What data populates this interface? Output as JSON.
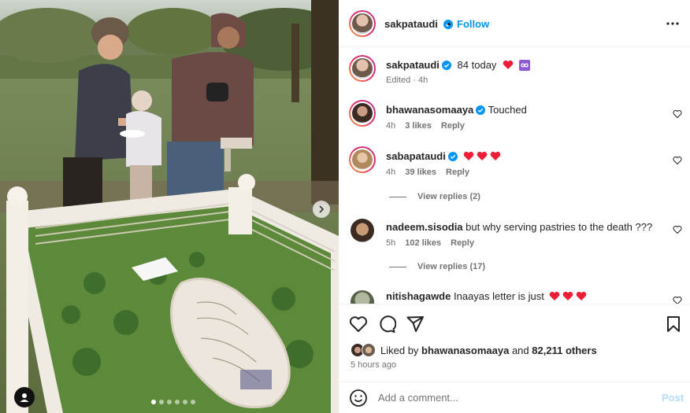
{
  "colors": {
    "accent": "#0095f6",
    "heart_red": "#ed1f36",
    "muted": "#737373",
    "text": "#262626"
  },
  "photo": {
    "slide_count": 6,
    "active_slide": 1,
    "next_icon": "chevron-right-icon",
    "tag_icon": "user-tag-icon"
  },
  "header": {
    "username": "sakpataudi",
    "separator": "•",
    "follow_label": "Follow",
    "more_icon": "more-horizontal-icon"
  },
  "caption": {
    "username": "sakpataudi",
    "text": "84 today",
    "emojis": [
      "red-heart",
      "infinity"
    ],
    "edited": "Edited · 4h"
  },
  "comments": [
    {
      "username": "bhawanasomaaya",
      "verified": true,
      "text": "Touched",
      "hearts": 0,
      "time": "4h",
      "likes": "3 likes",
      "reply": "Reply"
    },
    {
      "username": "sabapataudi",
      "verified": true,
      "text": "",
      "hearts": 3,
      "time": "4h",
      "likes": "39 likes",
      "reply": "Reply",
      "view_replies": "View replies (2)"
    },
    {
      "username": "nadeem.sisodia",
      "verified": false,
      "text": "but why serving pastries to the death ???",
      "hearts": 0,
      "time": "5h",
      "likes": "102 likes",
      "reply": "Reply",
      "view_replies": "View replies (17)"
    },
    {
      "username": "nitishagawde",
      "verified": false,
      "text": "Inaayas letter is just",
      "hearts": 3
    }
  ],
  "actions": {
    "like_icon": "heart-outline-icon",
    "comment_icon": "comment-icon",
    "share_icon": "send-icon",
    "save_icon": "bookmark-icon"
  },
  "likes": {
    "prefix": "Liked by",
    "first_user": "bhawanasomaaya",
    "joiner": "and",
    "others": "82,211 others",
    "time": "5 hours ago"
  },
  "comment_input": {
    "placeholder": "Add a comment...",
    "post_label": "Post",
    "emoji_icon": "emoji-icon"
  }
}
